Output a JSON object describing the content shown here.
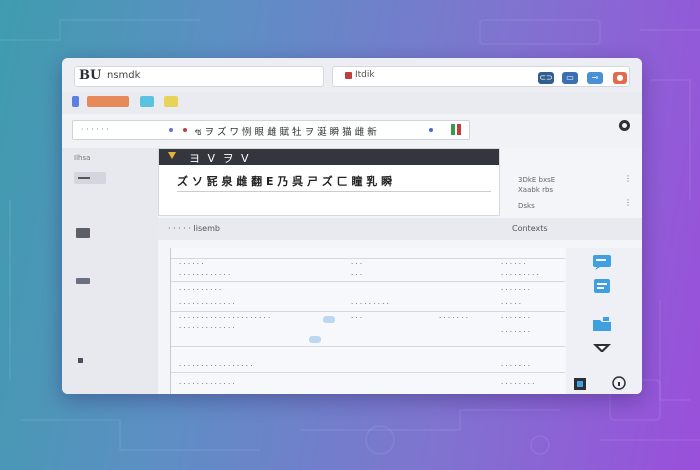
{
  "window": {
    "brand_logo": "BU",
    "brand_name": "nsmdk",
    "tab_label": "Itdik",
    "title_buttons": [
      {
        "name": "window-button-1",
        "color": "#2f5f8e"
      },
      {
        "name": "window-button-2",
        "color": "#3a6fb0"
      },
      {
        "name": "window-button-3",
        "color": "#4a90d6"
      },
      {
        "name": "window-button-4",
        "color": "#e36a4d"
      }
    ]
  },
  "toolbar": {
    "buttons": [
      {
        "name": "toolbar-button-1",
        "color": "#5b7fe3"
      },
      {
        "name": "toolbar-button-2",
        "color": "#e58a58"
      },
      {
        "name": "toolbar-button-3",
        "color": "#5bc2e0"
      },
      {
        "name": "toolbar-button-4",
        "color": "#e7d35a"
      }
    ]
  },
  "address": {
    "prefix": "· · · · · ·",
    "text": "ซ ヲ ズ ワ 㤡 眼 雌 賦 牡 ヲ 涎 瞬 猫 雌 新"
  },
  "sidebar": {
    "label": "Ilhsa"
  },
  "panel": {
    "header": "ヨ V ヲ V",
    "heading": "ズ ソ 㓃 泉 雌 翻 E 乃 呉 ㄕ ズ ㄈ 瞳 乳 瞬"
  },
  "side_info": {
    "lines": [
      "3DkE bxsE",
      "Xaabk rbs",
      "Dsks"
    ]
  },
  "section": {
    "left": "· · · · ·  Iisemb",
    "right": "Contexts"
  },
  "rows": [
    {
      "c1": "· · · · · ·",
      "c2": "· · · · ·",
      "c3": "· · ·",
      "c4": "· · · · · ·",
      "c5": "· · · · · ·"
    },
    {
      "c1": "· · · · · · · · · · · ·",
      "c2": "",
      "c3": "· · ·",
      "c4": "· · ·",
      "c5": "· · · · · · · · ·"
    },
    {
      "c1": "· · · · · · · · · ·",
      "c2": "",
      "c3": "",
      "c4": "",
      "c5": "· · · · · · ·"
    },
    {
      "c1": "· · · · · · · · · · · · ·",
      "c2": "",
      "c3": "· · · · · · · · ·",
      "c4": "· · ·",
      "c5": "· · · · ·"
    },
    {
      "c1": "· · · · · · · · · · · · · · · · · · · · ·",
      "c2": "",
      "c3": "· · ·",
      "c4": "· · · · · · ·",
      "c5": "· · · · · · ·"
    },
    {
      "c1": "· · · · · · · · · · · · ·",
      "c2": "",
      "c3": "",
      "c4": "",
      "c5": "· · · · · · ·"
    },
    {
      "c1": "· · · · · · · · · · · · · · · · ·",
      "c2": "",
      "c3": "",
      "c4": "",
      "c5": "· · · · · · ·"
    },
    {
      "c1": "· · · · · · · · · · · · ·",
      "c2": "",
      "c3": "",
      "c4": "",
      "c5": "· · · · · · · ·"
    }
  ],
  "colors": {
    "accent": "#4a90d6",
    "panel_header": "#33363c",
    "chevron": "#e8b23a"
  }
}
